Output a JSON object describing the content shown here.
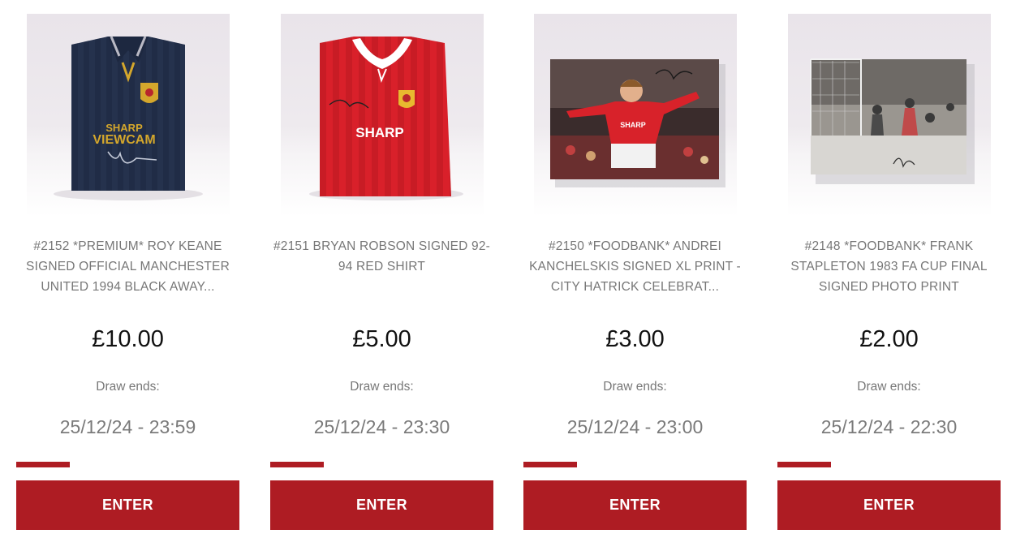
{
  "theme": {
    "accent": "#ae1c23",
    "text_muted": "#777777",
    "price_color": "#111111"
  },
  "competitions": [
    {
      "title": "#2152 *PREMIUM* ROY KEANE SIGNED OFFICIAL MANCHESTER UNITED 1994 BLACK AWAY...",
      "price": "£10.00",
      "draw_label": "Draw ends:",
      "draw_date": "25/12/24 - 23:59",
      "enter_label": "ENTER",
      "image_text": [
        "SHARP",
        "VIEWCAM"
      ],
      "progress_fraction": 0.24
    },
    {
      "title": "#2151 BRYAN ROBSON SIGNED 92-94 RED SHIRT",
      "price": "£5.00",
      "draw_label": "Draw ends:",
      "draw_date": "25/12/24 - 23:30",
      "enter_label": "ENTER",
      "image_text": [
        "SHARP"
      ],
      "progress_fraction": 0.24
    },
    {
      "title": "#2150 *FOODBANK* ANDREI KANCHELSKIS SIGNED XL PRINT - CITY HATRICK CELEBRAT...",
      "price": "£3.00",
      "draw_label": "Draw ends:",
      "draw_date": "25/12/24 - 23:00",
      "enter_label": "ENTER",
      "image_text": [
        "SHARP"
      ],
      "progress_fraction": 0.24
    },
    {
      "title": "#2148 *FOODBANK* FRANK STAPLETON 1983 FA CUP FINAL SIGNED PHOTO PRINT",
      "price": "£2.00",
      "draw_label": "Draw ends:",
      "draw_date": "25/12/24 - 22:30",
      "enter_label": "ENTER",
      "image_text": [],
      "progress_fraction": 0.24
    }
  ]
}
